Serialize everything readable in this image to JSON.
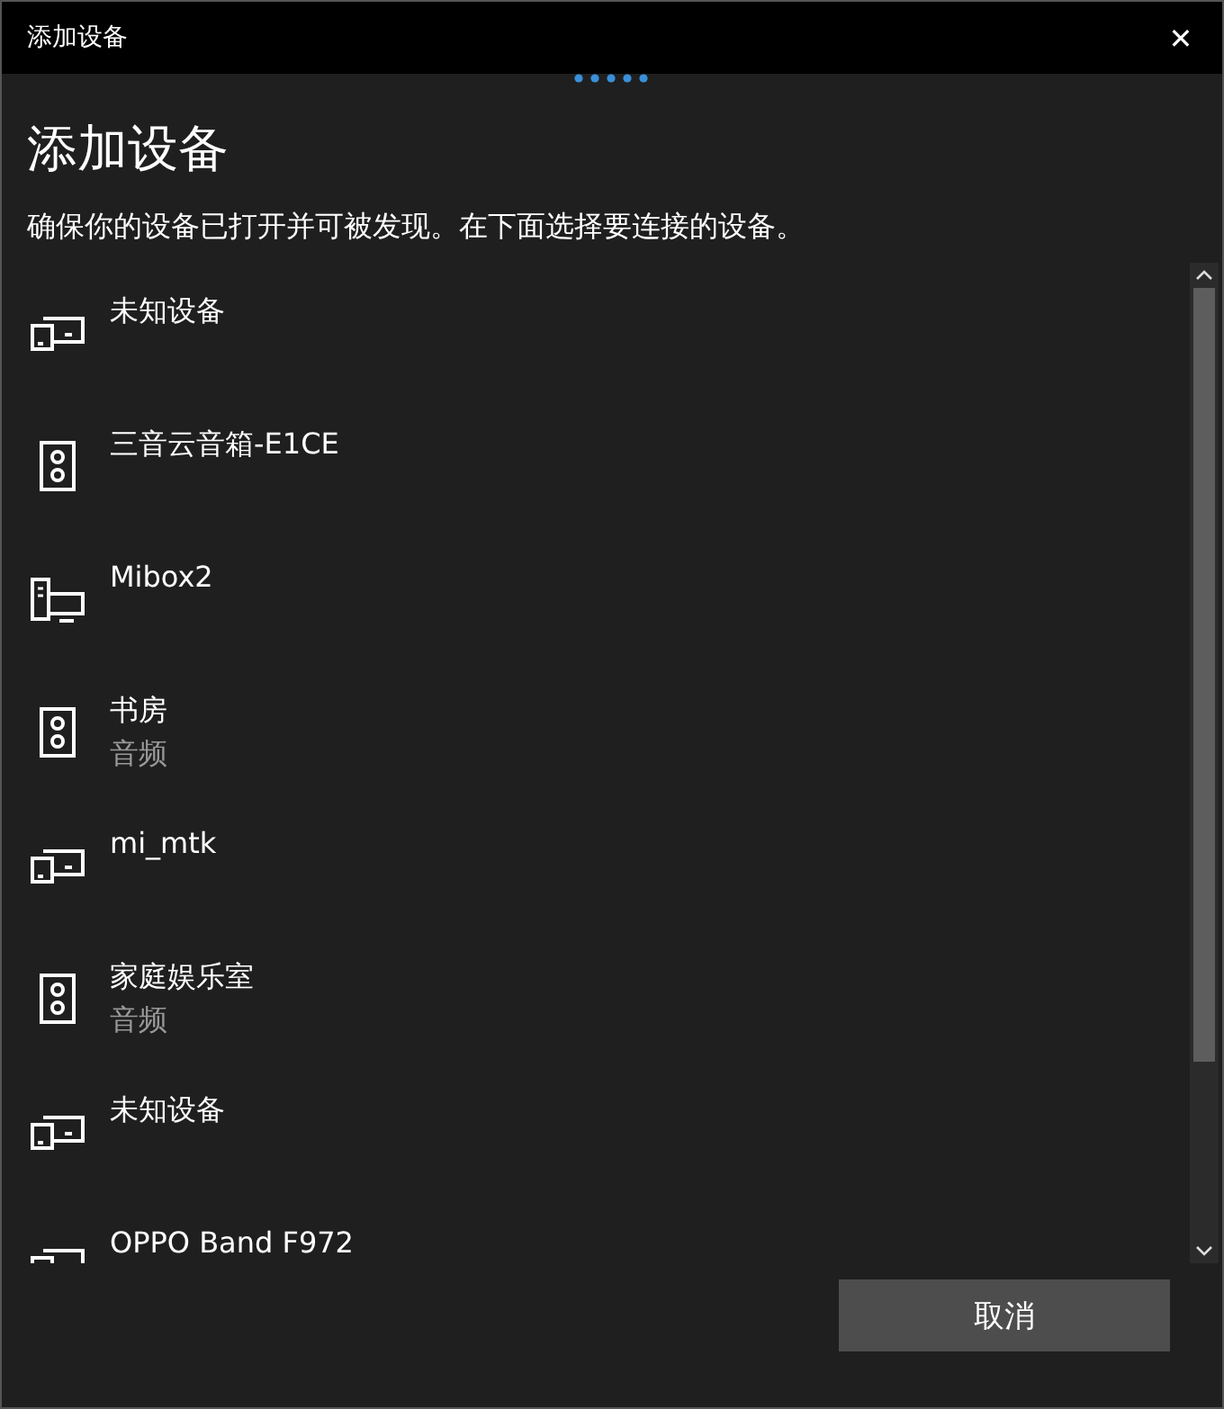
{
  "window": {
    "title": "添加设备",
    "close": "✕"
  },
  "heading": "添加设备",
  "instruction": "确保你的设备已打开并可被发现。在下面选择要连接的设备。",
  "devices": [
    {
      "kind": "device",
      "name": "未知设备"
    },
    {
      "kind": "speaker",
      "name": "三音云音箱-E1CE"
    },
    {
      "kind": "computer",
      "name": "Mibox2"
    },
    {
      "kind": "speaker",
      "name": "书房",
      "type": "音频"
    },
    {
      "kind": "device",
      "name": "mi_mtk"
    },
    {
      "kind": "speaker",
      "name": "家庭娱乐室",
      "type": "音频"
    },
    {
      "kind": "device",
      "name": "未知设备"
    },
    {
      "kind": "device",
      "name": "OPPO Band F972"
    }
  ],
  "buttons": [
    "取消"
  ]
}
